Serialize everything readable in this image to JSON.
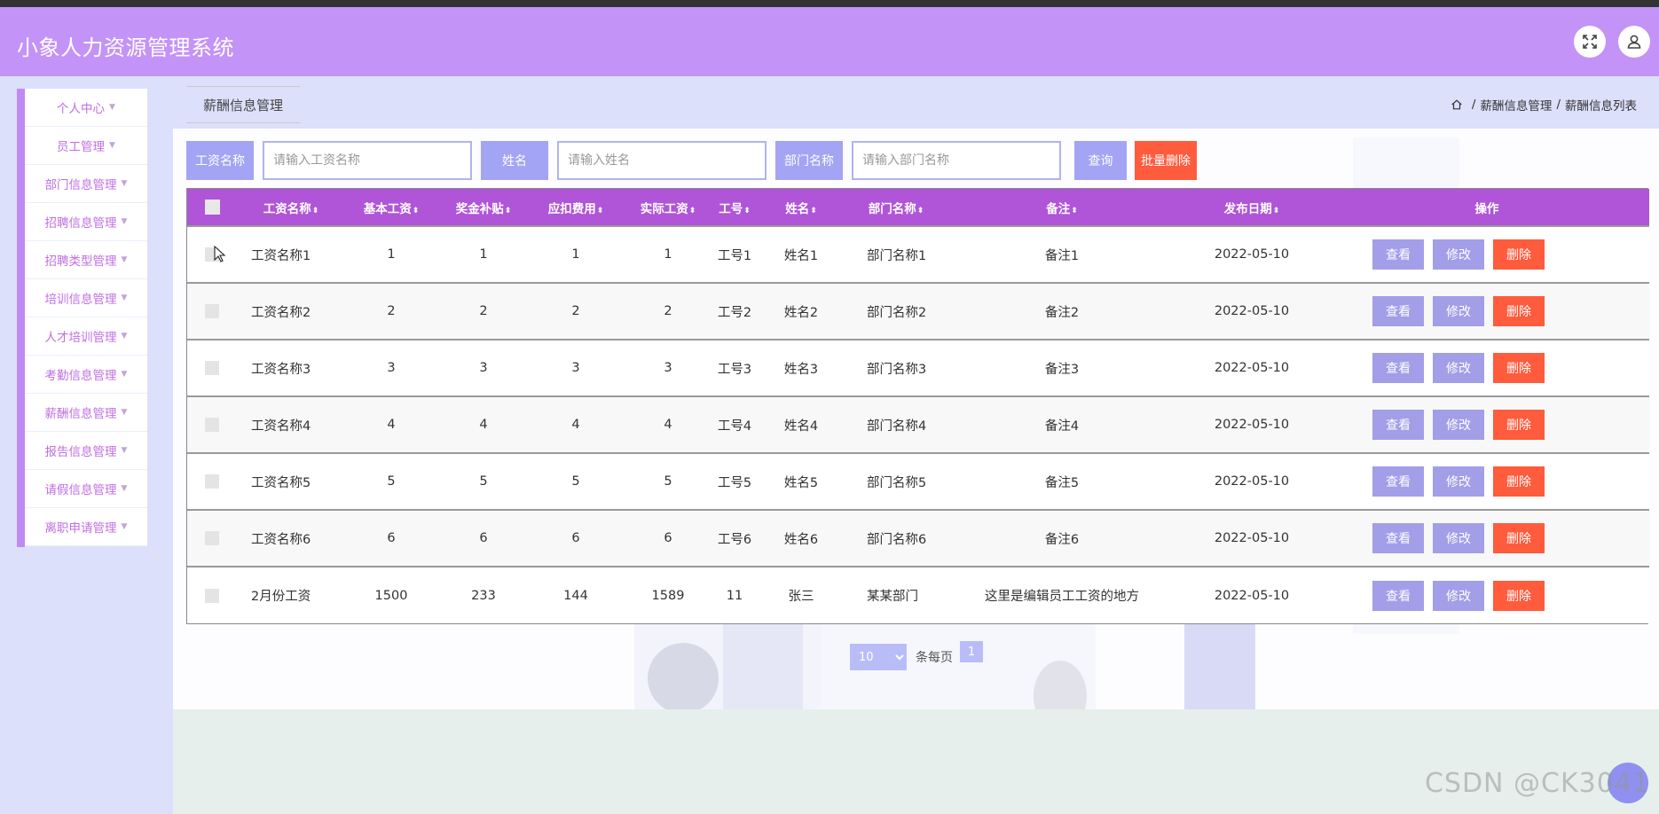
{
  "app": {
    "title": "小象人力资源管理系统"
  },
  "header": {
    "fullscreen_icon": "fullscreen-icon",
    "user_icon": "user-icon"
  },
  "sidebar": {
    "items": [
      {
        "label": "个人中心"
      },
      {
        "label": "员工管理"
      },
      {
        "label": "部门信息管理"
      },
      {
        "label": "招聘信息管理"
      },
      {
        "label": "招聘类型管理"
      },
      {
        "label": "培训信息管理"
      },
      {
        "label": "人才培训管理"
      },
      {
        "label": "考勤信息管理"
      },
      {
        "label": "薪酬信息管理"
      },
      {
        "label": "报告信息管理"
      },
      {
        "label": "请假信息管理"
      },
      {
        "label": "离职申请管理"
      }
    ]
  },
  "page": {
    "tab_title": "薪酬信息管理",
    "breadcrumb": [
      "薪酬信息管理",
      "薪酬信息列表"
    ]
  },
  "search": {
    "salary_name_label": "工资名称",
    "salary_name_placeholder": "请输入工资名称",
    "name_label": "姓名",
    "name_placeholder": "请输入姓名",
    "dept_label": "部门名称",
    "dept_placeholder": "请输入部门名称",
    "query_button": "查询",
    "batch_delete_button": "批量删除"
  },
  "table": {
    "columns": [
      "工资名称",
      "基本工资",
      "奖金补贴",
      "应扣费用",
      "实际工资",
      "工号",
      "姓名",
      "部门名称",
      "备注",
      "发布日期",
      "操作"
    ],
    "rows": [
      {
        "salary_name": "工资名称1",
        "base": "1",
        "bonus": "1",
        "deduct": "1",
        "actual": "1",
        "emp_no": "工号1",
        "name": "姓名1",
        "dept": "部门名称1",
        "remark": "备注1",
        "date": "2022-05-10"
      },
      {
        "salary_name": "工资名称2",
        "base": "2",
        "bonus": "2",
        "deduct": "2",
        "actual": "2",
        "emp_no": "工号2",
        "name": "姓名2",
        "dept": "部门名称2",
        "remark": "备注2",
        "date": "2022-05-10"
      },
      {
        "salary_name": "工资名称3",
        "base": "3",
        "bonus": "3",
        "deduct": "3",
        "actual": "3",
        "emp_no": "工号3",
        "name": "姓名3",
        "dept": "部门名称3",
        "remark": "备注3",
        "date": "2022-05-10"
      },
      {
        "salary_name": "工资名称4",
        "base": "4",
        "bonus": "4",
        "deduct": "4",
        "actual": "4",
        "emp_no": "工号4",
        "name": "姓名4",
        "dept": "部门名称4",
        "remark": "备注4",
        "date": "2022-05-10"
      },
      {
        "salary_name": "工资名称5",
        "base": "5",
        "bonus": "5",
        "deduct": "5",
        "actual": "5",
        "emp_no": "工号5",
        "name": "姓名5",
        "dept": "部门名称5",
        "remark": "备注5",
        "date": "2022-05-10"
      },
      {
        "salary_name": "工资名称6",
        "base": "6",
        "bonus": "6",
        "deduct": "6",
        "actual": "6",
        "emp_no": "工号6",
        "name": "姓名6",
        "dept": "部门名称6",
        "remark": "备注6",
        "date": "2022-05-10"
      },
      {
        "salary_name": "2月份工资",
        "base": "1500",
        "bonus": "233",
        "deduct": "144",
        "actual": "1589",
        "emp_no": "11",
        "name": "张三",
        "dept": "某某部门",
        "remark": "这里是编辑员工工资的地方",
        "date": "2022-05-10"
      }
    ],
    "actions": {
      "view": "查看",
      "edit": "修改",
      "delete": "删除"
    }
  },
  "pagination": {
    "page_size": "10",
    "per_page_label": "条每页",
    "current_page": "1"
  },
  "watermark": "CSDN @CK3041",
  "colors": {
    "header": "#c393f7",
    "accent": "#b054d8",
    "button": "#a29ee8",
    "danger": "#ff5b3d"
  }
}
